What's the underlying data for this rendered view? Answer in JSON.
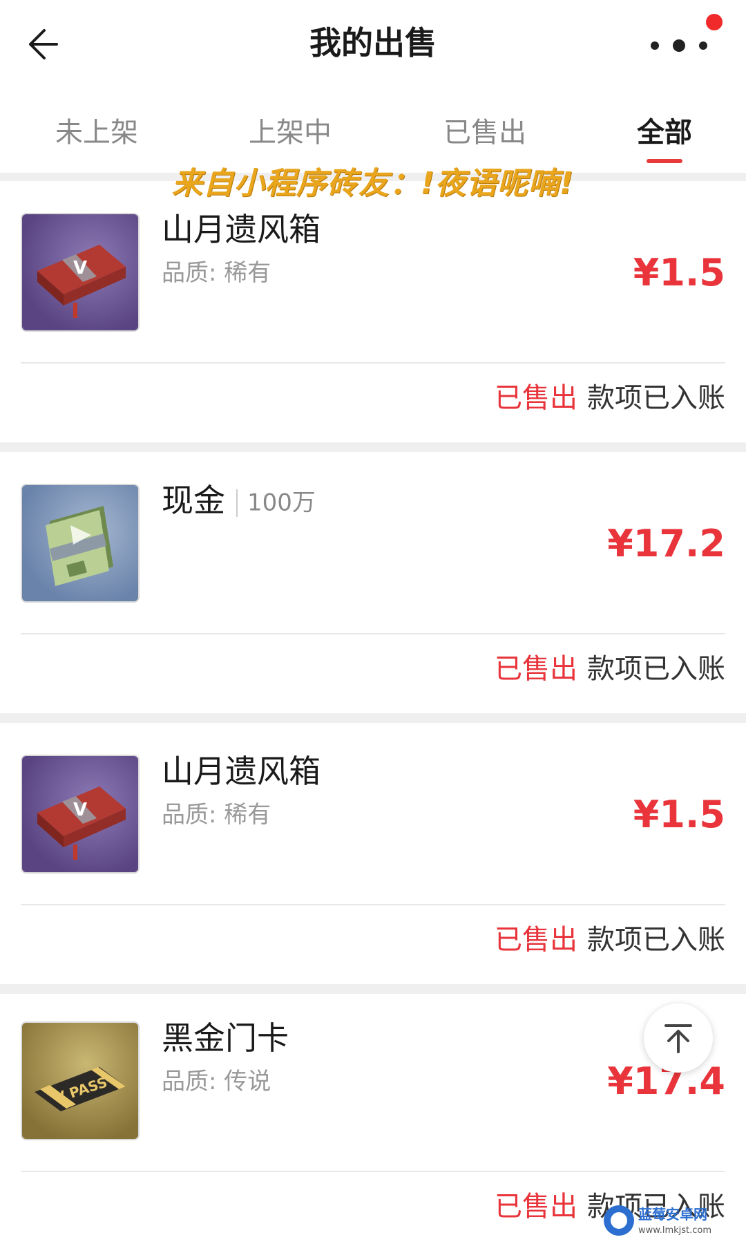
{
  "header": {
    "title": "我的出售"
  },
  "tabs": [
    {
      "label": "未上架",
      "active": false
    },
    {
      "label": "上架中",
      "active": false
    },
    {
      "label": "已售出",
      "active": false
    },
    {
      "label": "全部",
      "active": true
    }
  ],
  "watermark": "来自小程序砖友：!夜语呢喃!",
  "items": [
    {
      "name": "山月遗风箱",
      "quality": "品质: 稀有",
      "price": "¥1.5",
      "status_sold": "已售出",
      "status_paid": "款项已入账",
      "icon": "crate-icon"
    },
    {
      "name": "现金",
      "quantity": "100万",
      "price": "¥17.2",
      "status_sold": "已售出",
      "status_paid": "款项已入账",
      "icon": "cash-icon"
    },
    {
      "name": "山月遗风箱",
      "quality": "品质: 稀有",
      "price": "¥1.5",
      "status_sold": "已售出",
      "status_paid": "款项已入账",
      "icon": "crate-icon"
    },
    {
      "name": "黑金门卡",
      "quality": "品质: 传说",
      "price": "¥17.4",
      "status_sold": "已售出",
      "status_paid": "款项已入账",
      "icon": "pass-card-icon"
    }
  ],
  "colors": {
    "accent": "#e8343a",
    "watermark": "#e9a51c",
    "background": "#efefef"
  },
  "site_badge": {
    "name": "蓝莓安卓网",
    "url_text": "www.lmkjst.com"
  }
}
